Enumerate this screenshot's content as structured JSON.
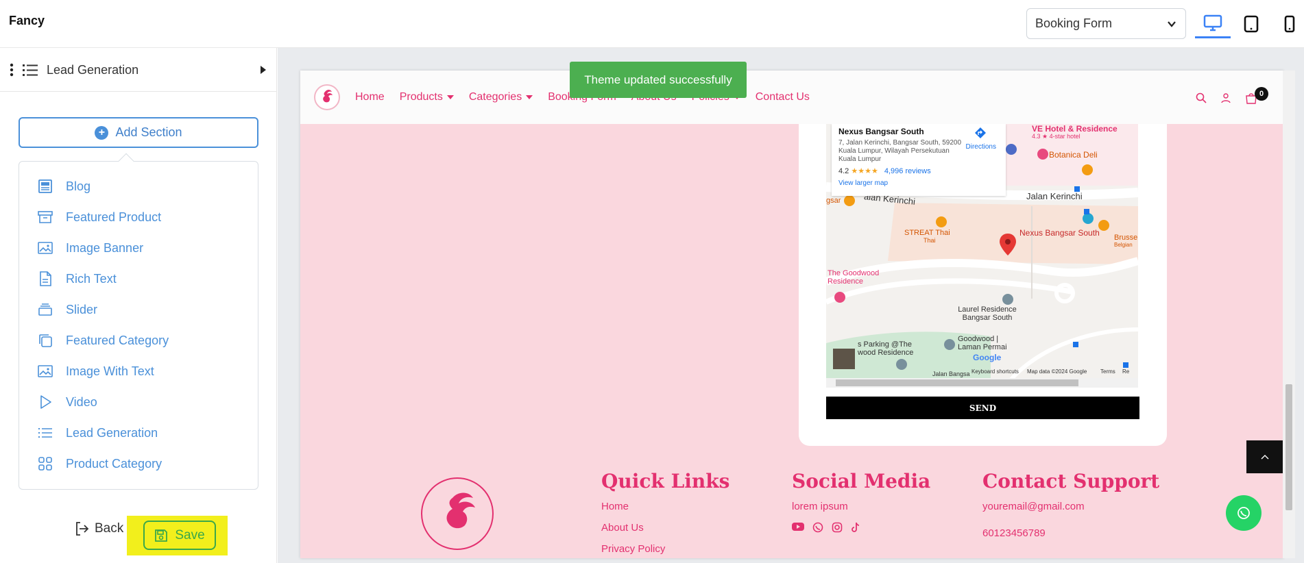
{
  "app": {
    "title": "Fancy"
  },
  "topbar": {
    "page_select": {
      "value": "Booking Form"
    },
    "devices": [
      {
        "name": "desktop",
        "active": true
      },
      {
        "name": "tablet",
        "active": false
      },
      {
        "name": "mobile",
        "active": false
      }
    ]
  },
  "sidebar": {
    "header_title": "Lead Generation",
    "add_section_label": "Add Section",
    "items": [
      {
        "label": "Blog",
        "icon": "blog-icon"
      },
      {
        "label": "Featured Product",
        "icon": "archive-box-icon"
      },
      {
        "label": "Image Banner",
        "icon": "image-icon"
      },
      {
        "label": "Rich Text",
        "icon": "document-icon"
      },
      {
        "label": "Slider",
        "icon": "layers-icon"
      },
      {
        "label": "Featured Category",
        "icon": "copy-icon"
      },
      {
        "label": "Image With Text",
        "icon": "image-icon"
      },
      {
        "label": "Video",
        "icon": "play-icon"
      },
      {
        "label": "Lead Generation",
        "icon": "list-icon"
      },
      {
        "label": "Product Category",
        "icon": "grid-icon"
      }
    ],
    "back_label": "Back",
    "save_label": "Save"
  },
  "toast": {
    "message": "Theme updated successfully"
  },
  "site": {
    "nav": [
      "Home",
      "Products",
      "Categories",
      "Booking Form",
      "About Us",
      "Policies",
      "Contact Us"
    ],
    "cart_count": "0",
    "map": {
      "place_name": "Nexus Bangsar South",
      "address": "7, Jalan Kerinchi, Bangsar South, 59200 Kuala Lumpur, Wilayah Persekutuan Kuala Lumpur",
      "rating": "4.2",
      "stars": "★★★★",
      "reviews": "4,996 reviews",
      "directions": "Directions",
      "view_larger": "View larger map",
      "labels": {
        "hotel": "VE Hotel & Residence",
        "hotel_rating": "4.3 ★ 4-star hotel",
        "botanica": "Botanica Deli",
        "street1": "Jalan Kerinchi",
        "street2": "alan Kerinchi",
        "streat": "STREAT Thai",
        "streat_sub": "Thai",
        "nexus": "Nexus Bangsar South",
        "brusse": "Brusse",
        "brusse_sub": "Belgian",
        "goodwood": "The Goodwood Residence",
        "laurel": "Laurel Residence Bangsar South",
        "goodwood2": "Goodwood | Laman Permai",
        "parking": "s Parking @The wood Residence",
        "gsar": "gsar",
        "jalan_bangsa": "Jalan Bangsa",
        "google": "Google"
      },
      "footer_items": [
        "Keyboard shortcuts",
        "Map data ©2024 Google",
        "Terms",
        "Re"
      ]
    },
    "send_label": "SEND",
    "footer": {
      "quick_links": {
        "title": "Quick Links",
        "links": [
          "Home",
          "About Us",
          "Privacy Policy"
        ]
      },
      "social": {
        "title": "Social Media",
        "text": "lorem ipsum",
        "icons": [
          "youtube-icon",
          "whatsapp-icon",
          "instagram-icon",
          "tiktok-icon"
        ]
      },
      "contact": {
        "title": "Contact Support",
        "email": "youremail@gmail.com",
        "phone": "60123456789"
      }
    }
  },
  "colors": {
    "accent_blue": "#4a90d9",
    "brand_pink": "#e3306f",
    "preview_bg": "#fad7de",
    "toast_green": "#4caf50",
    "save_green": "#3aa84a",
    "highlight_yellow": "#f2ef1c"
  }
}
